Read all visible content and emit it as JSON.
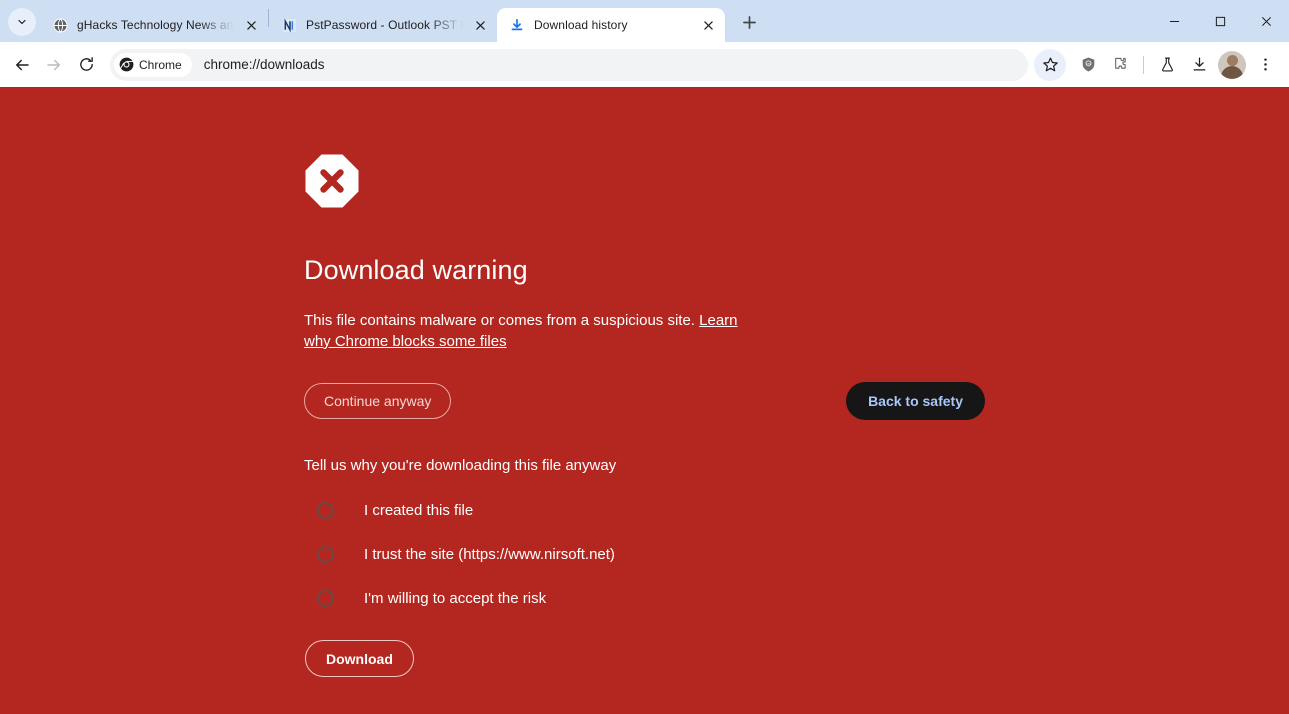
{
  "window": {
    "controls": {
      "minimize": "Minimize",
      "maximize": "Maximize",
      "close": "Close"
    }
  },
  "tabstrip": {
    "tab_search_tooltip": "Search tabs",
    "new_tab_label": "New Tab",
    "tabs": [
      {
        "title": "gHacks Technology News and A",
        "favicon": "globe-icon",
        "active": false,
        "close_label": "Close"
      },
      {
        "title": "PstPassword - Outlook PST Pas",
        "favicon": "nirsoft-icon",
        "active": false,
        "close_label": "Close"
      },
      {
        "title": "Download history",
        "favicon": "download-icon",
        "active": true,
        "close_label": "Close"
      }
    ]
  },
  "toolbar": {
    "back_label": "Back",
    "forward_label": "Forward",
    "reload_label": "Reload",
    "chrome_chip_label": "Chrome",
    "url": "chrome://downloads",
    "bookmark_label": "Bookmark this tab",
    "ublock_label": "uBlock Origin",
    "ublock_badge": "uo",
    "extensions_label": "Extensions",
    "experiments_label": "Experiments",
    "downloads_label": "Downloads",
    "profile_label": "Profile",
    "menu_label": "Customize and control Google Chrome"
  },
  "interstitial": {
    "icon": "blocked-octagon-icon",
    "title": "Download warning",
    "body_text": "This file contains malware or comes from a suspicious site.",
    "learn_more_link": "Learn why Chrome blocks some files",
    "continue_button": "Continue anyway",
    "back_to_safety_button": "Back to safety",
    "survey_prompt": "Tell us why you're downloading this file anyway",
    "options": [
      {
        "label": "I created this file",
        "selected": false
      },
      {
        "label": "I trust the site (https://www.nirsoft.net)",
        "selected": false
      },
      {
        "label": "I'm willing to accept the risk",
        "selected": false
      }
    ],
    "download_button": "Download"
  },
  "colors": {
    "page_background": "#b32720",
    "tabstrip_background": "#cedef3",
    "back_to_safety_background": "#161616",
    "back_to_safety_text": "#a8c7fa",
    "warning_icon": "#ffffff"
  }
}
